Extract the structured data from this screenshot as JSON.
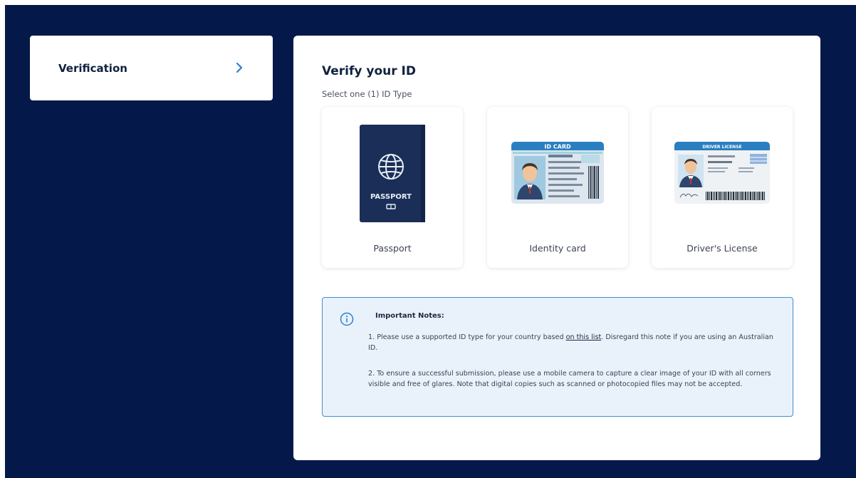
{
  "sidebar": {
    "items": [
      {
        "label": "Verification",
        "icon": "chevron-right-icon"
      }
    ]
  },
  "main": {
    "title": "Verify your ID",
    "subtitle": "Select one (1) ID Type",
    "options": [
      {
        "label": "Passport",
        "card_text": "PASSPORT",
        "icon": "passport-icon"
      },
      {
        "label": "Identity card",
        "card_text": "ID CARD",
        "icon": "id-card-icon"
      },
      {
        "label": "Driver's License",
        "card_text": "DRIVER LICENSE",
        "icon": "drivers-license-icon"
      }
    ],
    "notes": {
      "title": "Important Notes:",
      "note1_prefix": "1. Please use a supported ID type for your country based ",
      "note1_link": "on this list",
      "note1_suffix": ". Disregard this note if you are using an Australian ID.",
      "note2": "2. To ensure a successful submission, please use a mobile camera to capture a clear image of your ID with all corners visible and free of glares. Note that digital copies such as scanned or photocopied files may not be accepted."
    }
  },
  "colors": {
    "background": "#04194a",
    "card": "#ffffff",
    "notes_bg": "#e9f2fb",
    "notes_border": "#3f8fd6",
    "accent": "#2f7fd0"
  }
}
